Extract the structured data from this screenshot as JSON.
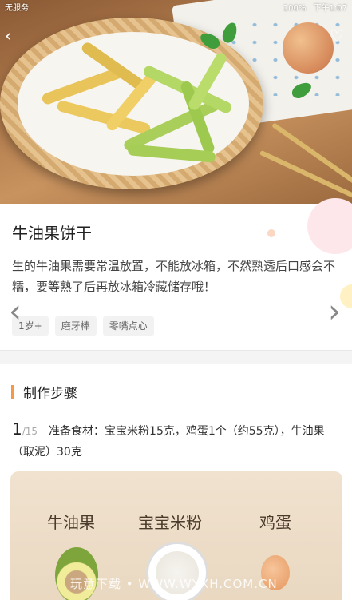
{
  "status_bar": {
    "carrier": "无服务",
    "battery": "100%",
    "time": "下午1:07"
  },
  "header": {
    "back_icon": "chevron-left-icon",
    "favorite_icon": "heart-icon"
  },
  "recipe": {
    "title": "牛油果饼干",
    "description": "生的牛油果需要常温放置，不能放冰箱，不然熟透后口感会不糯，要等熟了后再放冰箱冷藏储存哦！",
    "tags": [
      "1岁+",
      "磨牙棒",
      "零嘴点心"
    ]
  },
  "carousel": {
    "prev_icon": "chevron-left-icon",
    "next_icon": "chevron-right-icon"
  },
  "steps": {
    "heading": "制作步骤",
    "current": {
      "index": "1",
      "total": "/15",
      "text": "准备食材：宝宝米粉15克，鸡蛋1个（约55克），牛油果（取泥）30克"
    }
  },
  "step_photo": {
    "labels": [
      "牛油果",
      "宝宝米粉",
      "鸡蛋"
    ]
  },
  "watermark": "玩意下载 • WWW.WYXH.COM.CN",
  "colors": {
    "accent": "#f39a4a",
    "tag_bg": "#f2f2f2",
    "divider_bg": "#f4f4f4"
  }
}
